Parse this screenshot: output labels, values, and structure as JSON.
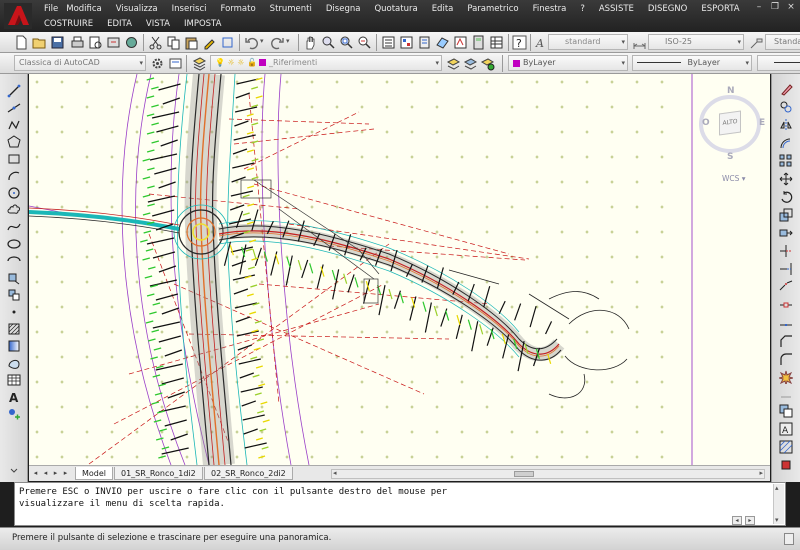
{
  "menus": {
    "row1": [
      "File",
      "Modifica",
      "Visualizza",
      "Inserisci",
      "Formato",
      "Strumenti",
      "Disegna",
      "Quotatura",
      "Edita",
      "Parametrico",
      "Finestra",
      "?",
      "ASSISTE",
      "DISEGNO",
      "ESPORTA"
    ],
    "row2": [
      "COSTRUIRE",
      "EDITA",
      "VISTA",
      "IMPOSTA"
    ]
  },
  "toolbar": {
    "text_style": "standard",
    "dim_style": "ISO-25",
    "multileader_style": "Standard"
  },
  "layers": {
    "workspace": "Classica di AutoCAD",
    "current_layer": "_Riferimenti",
    "color": "ByLayer",
    "linetype": "ByLayer",
    "layer_color": "#c000c0"
  },
  "viewcube": {
    "north": "N",
    "south": "S",
    "east": "E",
    "west": "O",
    "face": "ALTO",
    "wcs": "WCS"
  },
  "layout_tabs": {
    "model": "Model",
    "tab1": "01_SR_Ronco_1di2",
    "tab2": "02_SR_Ronco_2di2"
  },
  "command_line": {
    "line1": "Premere ESC o INVIO per uscire o fare clic con il pulsante destro del mouse per",
    "line2": "visualizzare il menu di scelta rapida."
  },
  "status_bar": {
    "message": "Premere il pulsante di selezione e trascinare per eseguire una panoramica."
  },
  "icons": {
    "app_logo": "autocad-logo",
    "pan_tool_active": "hand-pan-icon"
  }
}
